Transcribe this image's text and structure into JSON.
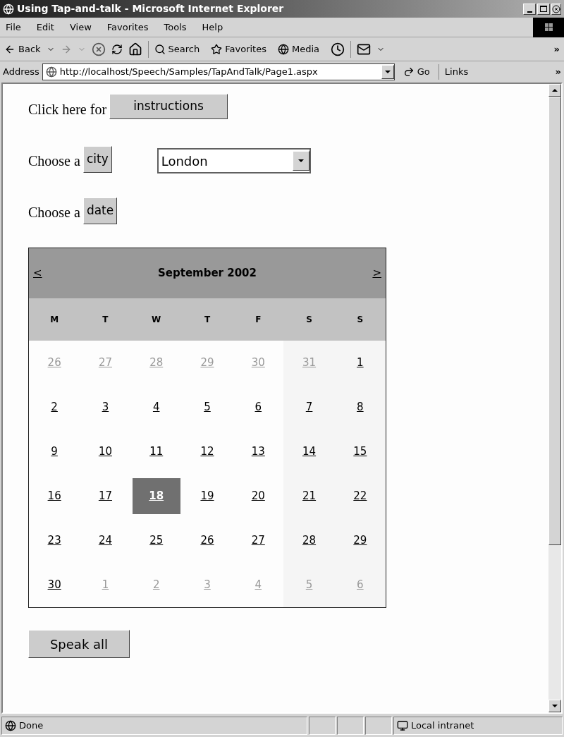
{
  "window": {
    "title": "Using Tap-and-talk - Microsoft Internet Explorer"
  },
  "menu": [
    "File",
    "Edit",
    "View",
    "Favorites",
    "Tools",
    "Help"
  ],
  "toolbar": {
    "back": "Back",
    "search": "Search",
    "favorites": "Favorites",
    "media": "Media",
    "more": "»"
  },
  "address": {
    "label": "Address",
    "url": "http://localhost/Speech/Samples/TapAndTalk/Page1.aspx",
    "go": "Go",
    "links": "Links",
    "more": "»"
  },
  "page": {
    "instructions": {
      "text": "Click here for",
      "button": "instructions"
    },
    "city": {
      "text": "Choose a",
      "button": "city",
      "value": "London"
    },
    "date": {
      "text": "Choose a",
      "button": "date"
    },
    "calendar": {
      "prev": "<",
      "next": ">",
      "title": "September 2002",
      "weekdays": [
        "M",
        "T",
        "W",
        "T",
        "F",
        "S",
        "S"
      ],
      "weeks": [
        [
          {
            "day": "26",
            "other_month": true,
            "selected": false
          },
          {
            "day": "27",
            "other_month": true,
            "selected": false
          },
          {
            "day": "28",
            "other_month": true,
            "selected": false
          },
          {
            "day": "29",
            "other_month": true,
            "selected": false
          },
          {
            "day": "30",
            "other_month": true,
            "selected": false
          },
          {
            "day": "31",
            "other_month": true,
            "selected": false
          },
          {
            "day": "1",
            "other_month": false,
            "selected": false
          }
        ],
        [
          {
            "day": "2",
            "other_month": false,
            "selected": false
          },
          {
            "day": "3",
            "other_month": false,
            "selected": false
          },
          {
            "day": "4",
            "other_month": false,
            "selected": false
          },
          {
            "day": "5",
            "other_month": false,
            "selected": false
          },
          {
            "day": "6",
            "other_month": false,
            "selected": false
          },
          {
            "day": "7",
            "other_month": false,
            "selected": false
          },
          {
            "day": "8",
            "other_month": false,
            "selected": false
          }
        ],
        [
          {
            "day": "9",
            "other_month": false,
            "selected": false
          },
          {
            "day": "10",
            "other_month": false,
            "selected": false
          },
          {
            "day": "11",
            "other_month": false,
            "selected": false
          },
          {
            "day": "12",
            "other_month": false,
            "selected": false
          },
          {
            "day": "13",
            "other_month": false,
            "selected": false
          },
          {
            "day": "14",
            "other_month": false,
            "selected": false
          },
          {
            "day": "15",
            "other_month": false,
            "selected": false
          }
        ],
        [
          {
            "day": "16",
            "other_month": false,
            "selected": false
          },
          {
            "day": "17",
            "other_month": false,
            "selected": false
          },
          {
            "day": "18",
            "other_month": false,
            "selected": true
          },
          {
            "day": "19",
            "other_month": false,
            "selected": false
          },
          {
            "day": "20",
            "other_month": false,
            "selected": false
          },
          {
            "day": "21",
            "other_month": false,
            "selected": false
          },
          {
            "day": "22",
            "other_month": false,
            "selected": false
          }
        ],
        [
          {
            "day": "23",
            "other_month": false,
            "selected": false
          },
          {
            "day": "24",
            "other_month": false,
            "selected": false
          },
          {
            "day": "25",
            "other_month": false,
            "selected": false
          },
          {
            "day": "26",
            "other_month": false,
            "selected": false
          },
          {
            "day": "27",
            "other_month": false,
            "selected": false
          },
          {
            "day": "28",
            "other_month": false,
            "selected": false
          },
          {
            "day": "29",
            "other_month": false,
            "selected": false
          }
        ],
        [
          {
            "day": "30",
            "other_month": false,
            "selected": false
          },
          {
            "day": "1",
            "other_month": true,
            "selected": false
          },
          {
            "day": "2",
            "other_month": true,
            "selected": false
          },
          {
            "day": "3",
            "other_month": true,
            "selected": false
          },
          {
            "day": "4",
            "other_month": true,
            "selected": false
          },
          {
            "day": "5",
            "other_month": true,
            "selected": false
          },
          {
            "day": "6",
            "other_month": true,
            "selected": false
          }
        ]
      ]
    },
    "speak_all": "Speak all"
  },
  "status_bar": {
    "text": "Done",
    "zone": "Local intranet"
  }
}
